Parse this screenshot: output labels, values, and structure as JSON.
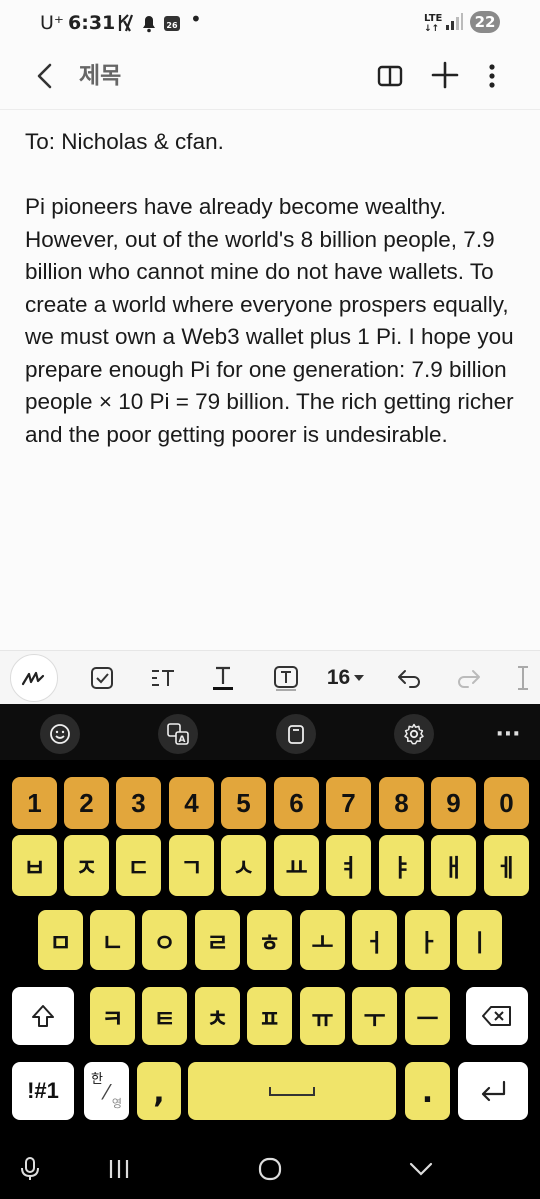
{
  "status_bar": {
    "carrier": "U⁺",
    "time": "6:31",
    "calendar_day": "26",
    "network_type": "LTE",
    "battery": "22"
  },
  "header": {
    "title": "제목"
  },
  "note": {
    "text": "To: Nicholas & cfan.\n\nPi pioneers have already become wealthy. However, out of the world's 8 billion people, 7.9 billion who cannot mine do not have wallets. To create a world where everyone prospers equally, we must own a Web3 wallet plus 1 Pi. I hope you prepare enough Pi for one generation: 7.9 billion people × 10 Pi = 79 billion. The rich getting richer and the poor getting poorer is undesirable."
  },
  "toolbar": {
    "font_size": "16"
  },
  "keyboard": {
    "number_row": [
      "1",
      "2",
      "3",
      "4",
      "5",
      "6",
      "7",
      "8",
      "9",
      "0"
    ],
    "row1": [
      "ㅂ",
      "ㅈ",
      "ㄷ",
      "ㄱ",
      "ㅅ",
      "ㅛ",
      "ㅕ",
      "ㅑ",
      "ㅐ",
      "ㅔ"
    ],
    "row2": [
      "ㅁ",
      "ㄴ",
      "ㅇ",
      "ㄹ",
      "ㅎ",
      "ㅗ",
      "ㅓ",
      "ㅏ",
      "ㅣ"
    ],
    "row3": [
      "ㅋ",
      "ㅌ",
      "ㅊ",
      "ㅍ",
      "ㅠ",
      "ㅜ",
      "ㅡ"
    ],
    "symbols_label": "!#1",
    "lang_top": "한",
    "lang_bottom": "영",
    "comma": ",",
    "period": ".",
    "colors": {
      "number_key": "#e2a63c",
      "letter_key": "#f0e46a",
      "function_key": "#ffffff",
      "background": "#000000"
    }
  }
}
